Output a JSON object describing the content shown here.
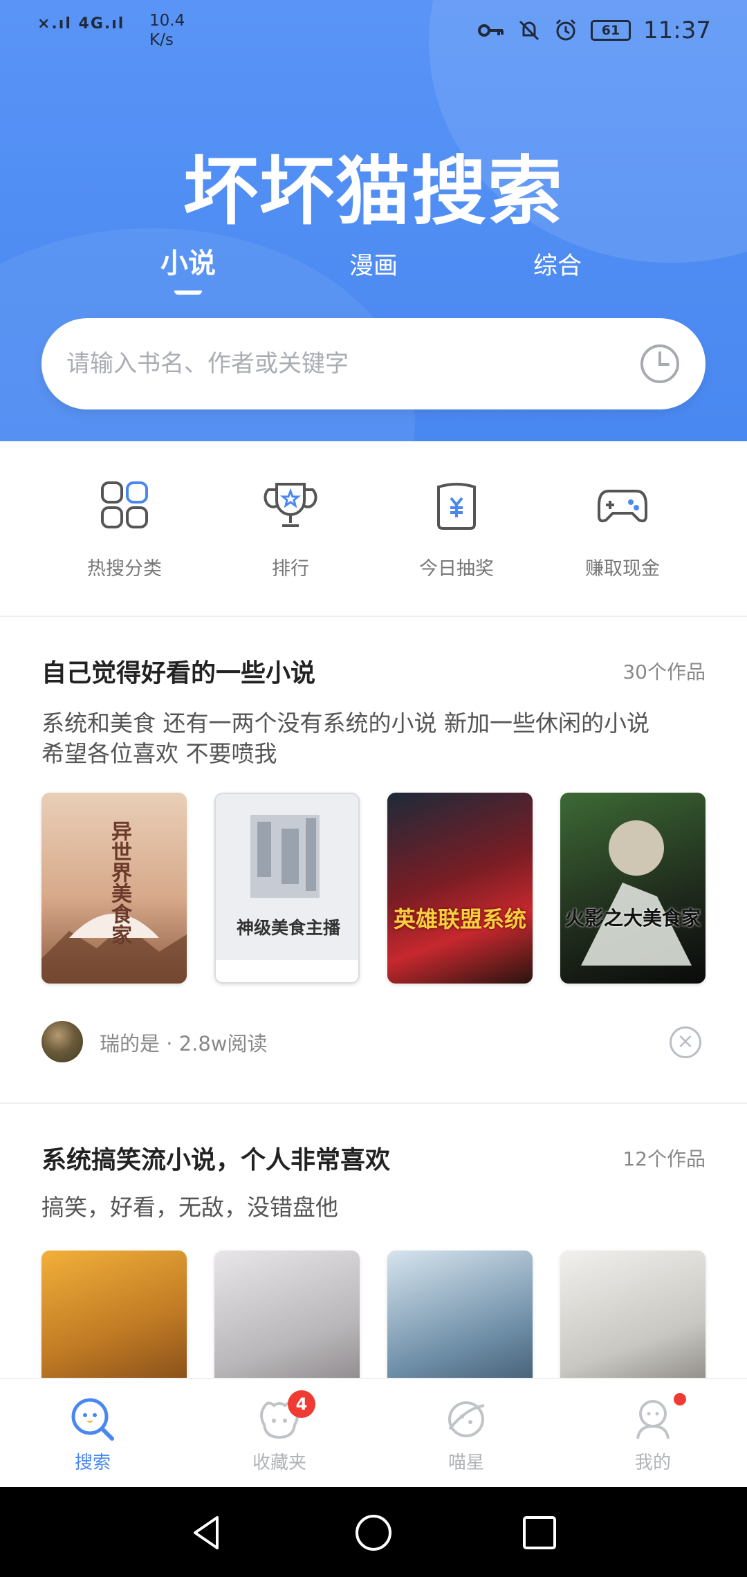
{
  "status_bar": {
    "network": "×.ıl 4G.ıl",
    "speed_value": "10.4",
    "speed_unit": "K/s",
    "battery": "61",
    "time": "11:37"
  },
  "header": {
    "app_title": "坏坏猫搜索",
    "tabs": [
      {
        "label": "小说",
        "active": true
      },
      {
        "label": "漫画",
        "active": false
      },
      {
        "label": "综合",
        "active": false
      }
    ],
    "search_placeholder": "请输入书名、作者或关键字"
  },
  "quick_actions": [
    {
      "label": "热搜分类",
      "icon": "grid-icon"
    },
    {
      "label": "排行",
      "icon": "trophy-icon"
    },
    {
      "label": "今日抽奖",
      "icon": "lottery-icon"
    },
    {
      "label": "赚取现金",
      "icon": "gamepad-icon"
    }
  ],
  "lists": [
    {
      "title": "自己觉得好看的一些小说",
      "count": "30个作品",
      "desc_line1": "系统和美食 还有一两个没有系统的小说 新加一些休闲的小说",
      "desc_line2": "希望各位喜欢 不要喷我",
      "covers": [
        {
          "text": "异世界美食家",
          "color": "#d9b59a"
        },
        {
          "text": "神级美食主播",
          "color": "#eceef2"
        },
        {
          "text": "英雄联盟系统",
          "color": "#7a1d24"
        },
        {
          "text": "火影之大美食家",
          "color": "#2f4a2a"
        }
      ],
      "author": "瑞的是 · 2.8w阅读"
    },
    {
      "title": "系统搞笑流小说，个人非常喜欢",
      "count": "12个作品",
      "desc_line1": "搞笑，好看，无敌，没错盘他",
      "covers": [
        {
          "color": "#c07a24"
        },
        {
          "color": "#b8b6b8"
        },
        {
          "color": "#6f8fa8"
        },
        {
          "color": "#c9c7c2"
        }
      ]
    }
  ],
  "bottom_nav": [
    {
      "label": "搜索",
      "active": true
    },
    {
      "label": "收藏夹",
      "badge": "4"
    },
    {
      "label": "喵星"
    },
    {
      "label": "我的"
    }
  ],
  "colors": {
    "accent": "#4a88f1",
    "badge": "#ef3b33"
  }
}
